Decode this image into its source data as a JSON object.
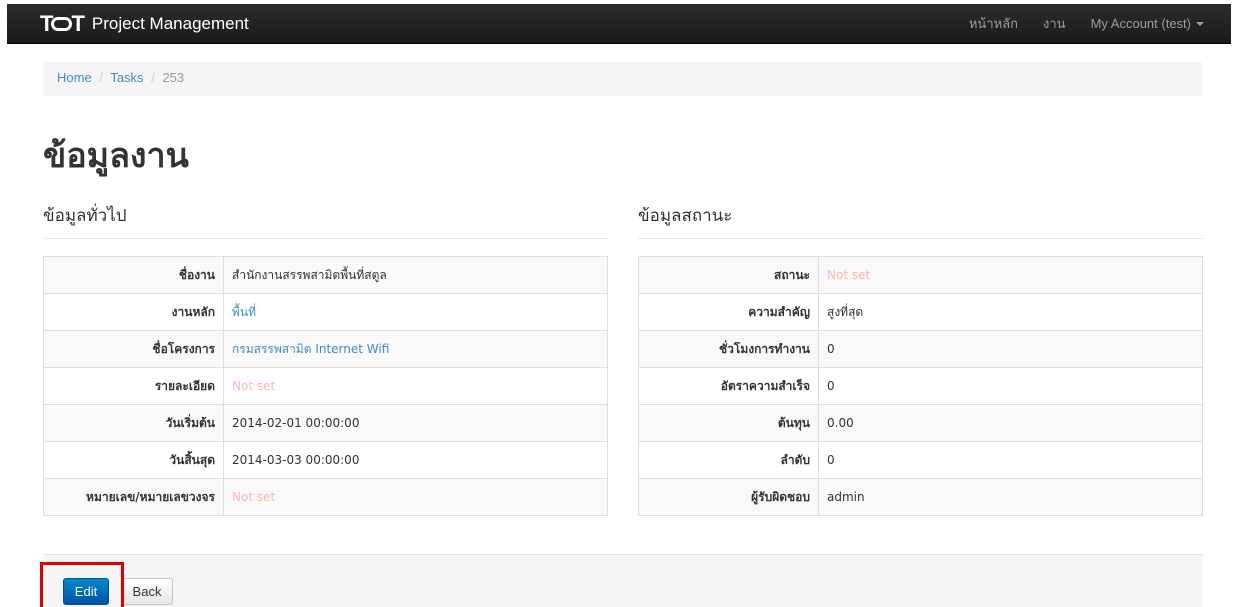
{
  "navbar": {
    "brand": "Project Management",
    "logo": "TOT",
    "links": [
      "หน้าหลัก",
      "งาน"
    ],
    "account": "My Account (test)"
  },
  "breadcrumb": {
    "home": "Home",
    "tasks": "Tasks",
    "current": "253",
    "separator": "/"
  },
  "page_title": "ข้อมูลงาน",
  "general": {
    "heading": "ข้อมูลทั่วไป",
    "rows": [
      {
        "label": "ชื่องาน",
        "value": "สำนักงานสรรพสามิตพื้นที่สตูล"
      },
      {
        "label": "งานหลัก",
        "value": "พื้นที่"
      },
      {
        "label": "ชื่อโครงการ",
        "value": "กรมสรรพสามิต Internet Wifi"
      },
      {
        "label": "รายละเอียด",
        "value": "Not set"
      },
      {
        "label": "วันเริ่มต้น",
        "value": "2014-02-01 00:00:00"
      },
      {
        "label": "วันสิ้นสุด",
        "value": "2014-03-03 00:00:00"
      },
      {
        "label": "หมายเลข/หมายเลขวงจร",
        "value": "Not set"
      }
    ]
  },
  "status": {
    "heading": "ข้อมูลสถานะ",
    "rows": [
      {
        "label": "สถานะ",
        "value": "Not set"
      },
      {
        "label": "ความสำคัญ",
        "value": "สูงที่สุด"
      },
      {
        "label": "ชั่วโมงการทำงาน",
        "value": "0"
      },
      {
        "label": "อัตราความสำเร็จ",
        "value": "0"
      },
      {
        "label": "ต้นทุน",
        "value": "0.00"
      },
      {
        "label": "ลำดับ",
        "value": "0"
      },
      {
        "label": "ผู้รับผิดชอบ",
        "value": "admin"
      }
    ]
  },
  "actions": {
    "edit": "Edit",
    "back": "Back"
  },
  "colors": {
    "navbar": "#222222",
    "link": "#428bca",
    "not_set": "#ffb3b3",
    "primary_button": "#006dcc",
    "highlight": "#e00000"
  }
}
